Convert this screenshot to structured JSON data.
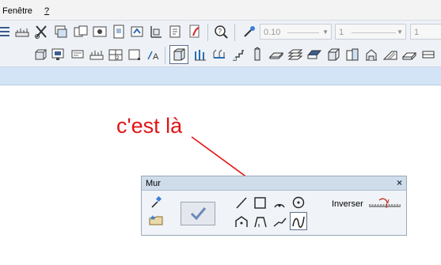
{
  "menubar": {
    "items": [
      {
        "label": "Fenêtre"
      },
      {
        "label": "?"
      }
    ]
  },
  "toolbar": {
    "line_width_value": "0.10",
    "line_type_value": "1",
    "pen_value": "1"
  },
  "annotation": {
    "text": "c'est là",
    "color": "#e01515"
  },
  "palette": {
    "title": "Mur",
    "close_label": "×",
    "invert_label": "Inverser"
  },
  "colors": {
    "menubar_bg": "#f3f3f3",
    "toolbar_bg": "#eef2f7",
    "ribbon_bg": "#d3e4f6",
    "palette_title_bg": "#cfdcea",
    "annotation_red": "#e01515"
  },
  "icons": {
    "toolbar1": [
      "list-icon",
      "measure-icon",
      "scissors-icon",
      "layers-icon",
      "documents-icon",
      "eye-icon",
      "page-icon",
      "import-icon",
      "export-icon",
      "pdf-icon",
      "zoom-search-icon",
      "eyedropper-icon"
    ],
    "toolbar2": [
      "cube-view-icon",
      "render-icon",
      "screen-icon",
      "dimension-icon",
      "grid-icon",
      "rectangle-icon",
      "text-a-icon",
      "wall-icon",
      "columns-icon",
      "beam-icon",
      "stairs-icon",
      "pillar-icon",
      "slab-icon",
      "roof-icon",
      "box-icon",
      "elevation-icon",
      "ramp-icon",
      "window-icon"
    ],
    "palette_tools": [
      "line-tool-icon",
      "rectangle-tool-icon",
      "arc-tool-icon",
      "circle-tool-icon",
      "polygon-tool-icon",
      "trapezoid-tool-icon",
      "polyline-tool-icon",
      "spline-tool-icon"
    ]
  }
}
